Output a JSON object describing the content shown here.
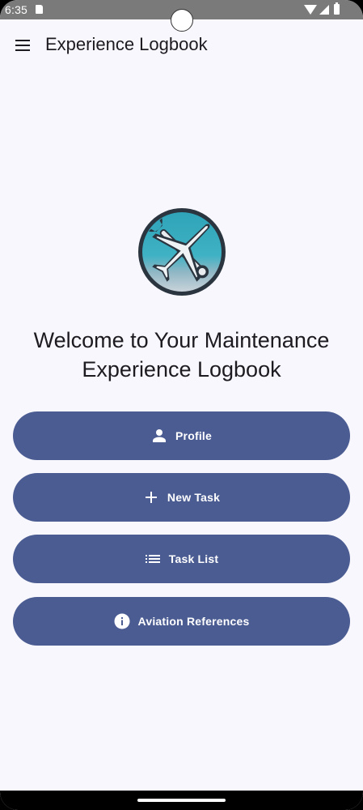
{
  "status_bar": {
    "time": "6:35",
    "icons": [
      "sd-card-icon",
      "wifi-icon",
      "signal-icon",
      "battery-icon"
    ]
  },
  "app_bar": {
    "title": "Experience Logbook",
    "menu_icon": "menu-icon"
  },
  "main": {
    "logo_icon": "airplane-wrench-logo",
    "welcome_line1": "Welcome to Your Maintenance",
    "welcome_line2": "Experience Logbook",
    "buttons": [
      {
        "label": "Profile",
        "icon": "person-icon"
      },
      {
        "label": "New Task",
        "icon": "plus-icon"
      },
      {
        "label": "Task List",
        "icon": "list-icon"
      },
      {
        "label": "Aviation References",
        "icon": "info-icon"
      }
    ]
  },
  "colors": {
    "background": "#f8f7fd",
    "button": "#4b5c92",
    "button_text": "#ffffff",
    "title_text": "#1d1b20",
    "status_bar": "#7a7a7a"
  }
}
